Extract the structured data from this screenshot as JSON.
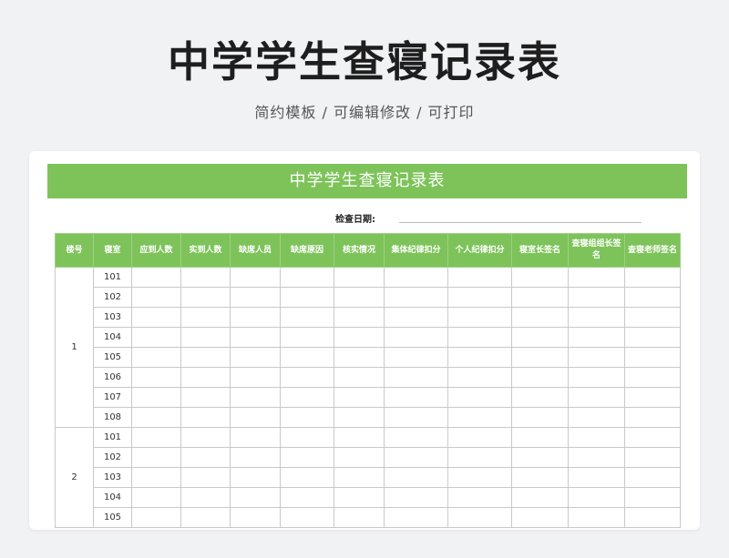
{
  "header": {
    "title": "中学学生查寝记录表",
    "subtitle": "简约模板 /  可编辑修改  / 可打印"
  },
  "sheet": {
    "banner_title": "中学学生查寝记录表",
    "check_date_label": "检查日期:",
    "check_date_value": "",
    "theme_color": "#7dc35a",
    "columns": [
      "楼号",
      "寝室",
      "应到人数",
      "实到人数",
      "缺席人员",
      "缺席原因",
      "核实情况",
      "集体纪律扣分",
      "个人纪律扣分",
      "寝室长签名",
      "查寝组组长签名",
      "查寝老师签名"
    ],
    "floors": [
      {
        "floor": "1",
        "rooms": [
          "101",
          "102",
          "103",
          "104",
          "105",
          "106",
          "107",
          "108"
        ]
      },
      {
        "floor": "2",
        "rooms": [
          "101",
          "102",
          "103",
          "104",
          "105"
        ]
      }
    ]
  }
}
